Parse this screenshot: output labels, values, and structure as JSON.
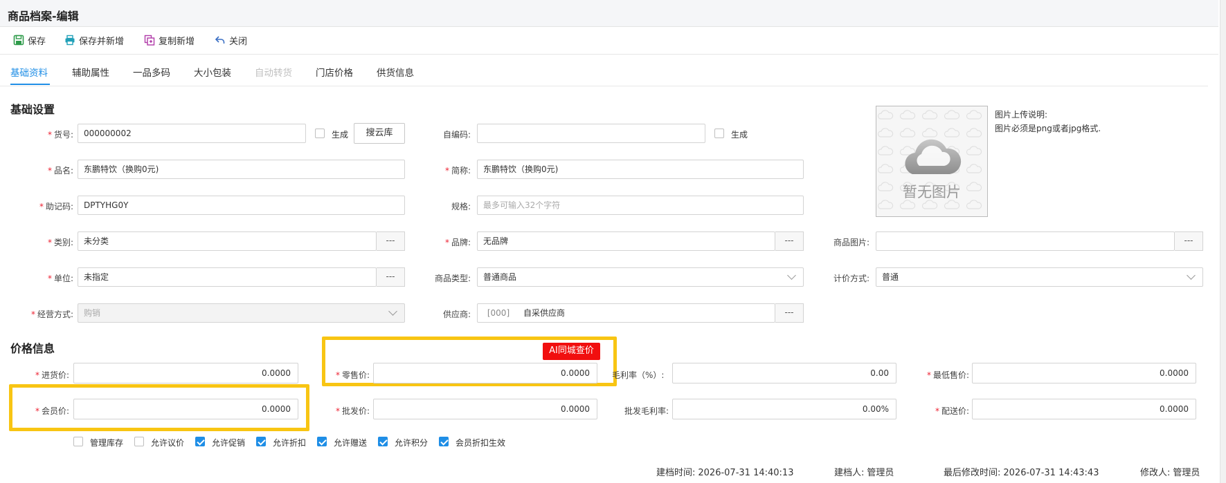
{
  "window": {
    "title": "商品档案-编辑"
  },
  "toolbar": {
    "save": "保存",
    "save_new": "保存并新增",
    "copy_new": "复制新增",
    "close": "关闭"
  },
  "tabs": [
    {
      "label": "基础资料",
      "state": "active"
    },
    {
      "label": "辅助属性",
      "state": "normal"
    },
    {
      "label": "一品多码",
      "state": "normal"
    },
    {
      "label": "大小包装",
      "state": "normal"
    },
    {
      "label": "自动转货",
      "state": "disabled"
    },
    {
      "label": "门店价格",
      "state": "normal"
    },
    {
      "label": "供货信息",
      "state": "normal"
    }
  ],
  "basic": {
    "section_title": "基础设置",
    "sku": {
      "label": "货号:",
      "value": "000000002",
      "generate": "生成",
      "search_btn": "搜云库"
    },
    "custom_code": {
      "label": "自编码:",
      "value": "",
      "generate": "生成"
    },
    "name": {
      "label": "品名:",
      "value": "东鹏特饮（换购0元)"
    },
    "short_name": {
      "label": "简称:",
      "value": "东鹏特饮（换购0元)"
    },
    "mnemonic": {
      "label": "助记码:",
      "value": "DPTYHG0Y"
    },
    "spec": {
      "label": "规格:",
      "placeholder": "最多可输入32个字符"
    },
    "category": {
      "label": "类别:",
      "value": "未分类",
      "btn": "---"
    },
    "brand": {
      "label": "品牌:",
      "value": "无品牌",
      "btn": "---"
    },
    "product_image": {
      "label": "商品图片:",
      "value": "",
      "btn": "---"
    },
    "unit": {
      "label": "单位:",
      "value": "未指定",
      "btn": "---"
    },
    "product_type": {
      "label": "商品类型:",
      "value": "普通商品"
    },
    "pricing_method": {
      "label": "计价方式:",
      "value": "普通"
    },
    "business_mode": {
      "label": "经营方式:",
      "value": "购销"
    },
    "supplier": {
      "label": "供应商:",
      "code": "[000]",
      "value": "自采供应商",
      "btn": "---"
    }
  },
  "image": {
    "placeholder_text": "暂无图片",
    "note_title": "图片上传说明:",
    "note_text": "图片必须是png或者jpg格式."
  },
  "price": {
    "section_title": "价格信息",
    "ai_button": "AI同城查价",
    "purchase": {
      "label": "进货价:",
      "value": "0.0000"
    },
    "retail": {
      "label": "零售价:",
      "value": "0.0000"
    },
    "gross_margin": {
      "label": "毛利率（%）:",
      "value": "0.00"
    },
    "min_price": {
      "label": "最低售价:",
      "value": "0.0000"
    },
    "member": {
      "label": "会员价:",
      "value": "0.0000"
    },
    "wholesale": {
      "label": "批发价:",
      "value": "0.0000"
    },
    "wholesale_margin": {
      "label": "批发毛利率:",
      "value": "0.00%"
    },
    "delivery": {
      "label": "配送价:",
      "value": "0.0000"
    }
  },
  "options": [
    {
      "label": "管理库存",
      "checked": false
    },
    {
      "label": "允许议价",
      "checked": false
    },
    {
      "label": "允许促销",
      "checked": true
    },
    {
      "label": "允许折扣",
      "checked": true
    },
    {
      "label": "允许赠送",
      "checked": true
    },
    {
      "label": "允许积分",
      "checked": true
    },
    {
      "label": "会员折扣生效",
      "checked": true
    }
  ],
  "footer": {
    "created_time_label": "建档时间:",
    "created_time": "2026-07-31 14:40:13",
    "creator_label": "建档人:",
    "creator": "管理员",
    "modified_time_label": "最后修改时间:",
    "modified_time": "2026-07-31 14:43:43",
    "modifier_label": "修改人:",
    "modifier": "管理员"
  },
  "colors": {
    "accent": "#1f8ee6",
    "highlight": "#f8c513",
    "ai_button": "#f10f0f",
    "required": "#e23333"
  }
}
